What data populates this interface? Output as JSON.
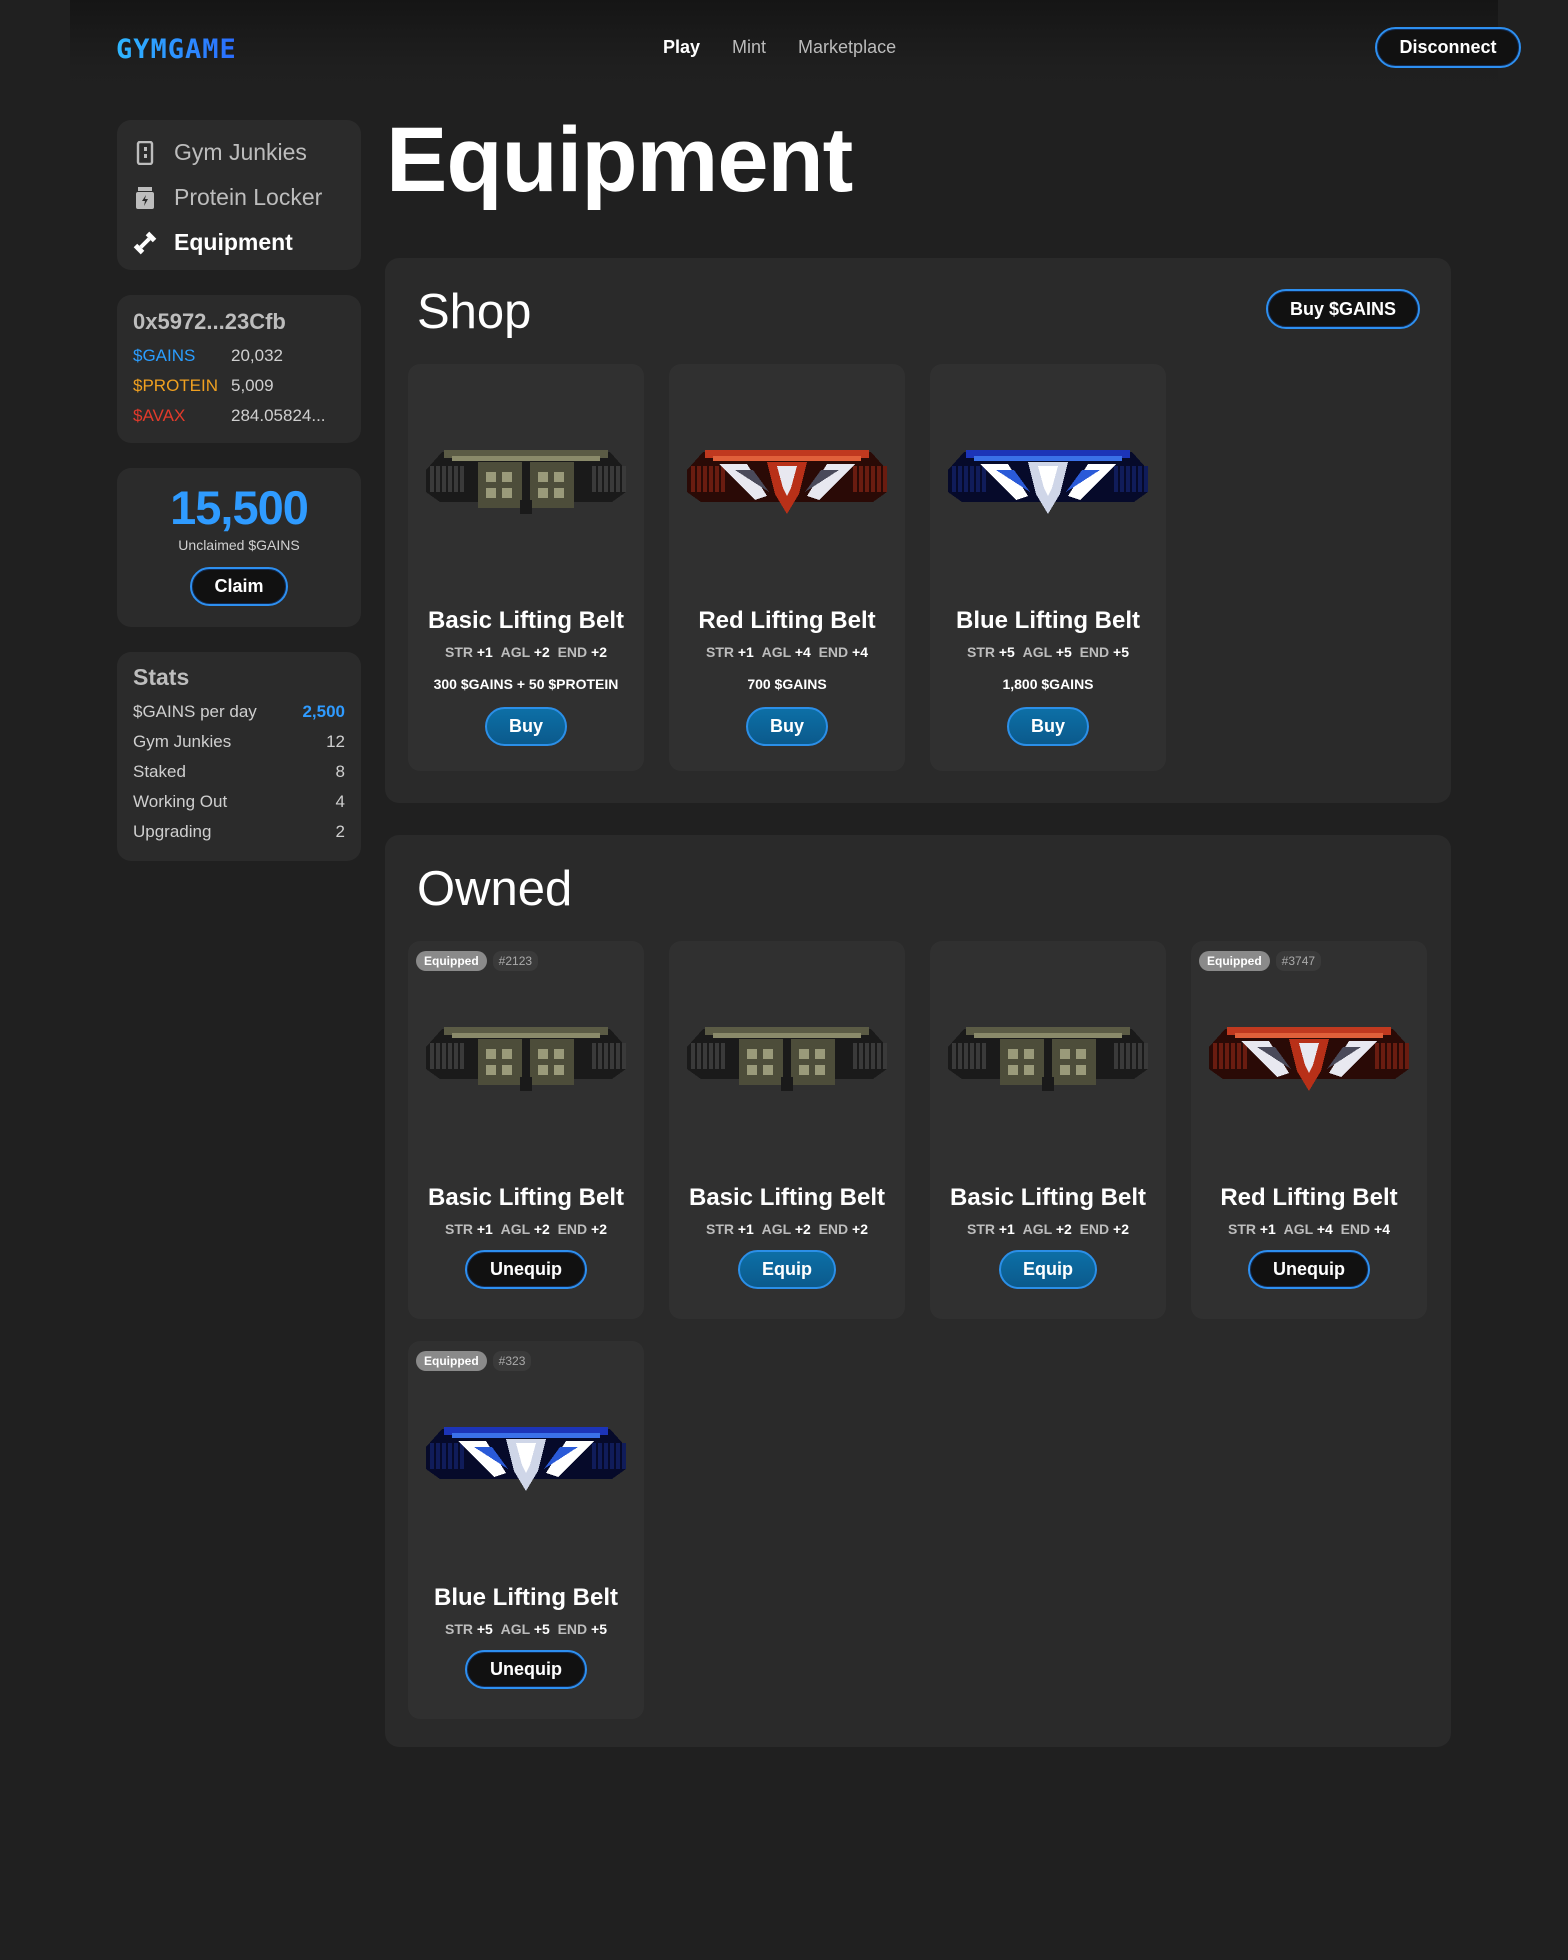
{
  "header": {
    "logo": "GYMGAME",
    "nav": [
      "Play",
      "Mint",
      "Marketplace"
    ],
    "disconnect_label": "Disconnect"
  },
  "sidebar": {
    "menu": [
      {
        "label": "Gym Junkies",
        "icon": "phone-icon"
      },
      {
        "label": "Protein Locker",
        "icon": "protein-jar-icon"
      },
      {
        "label": "Equipment",
        "icon": "dumbbell-icon"
      }
    ],
    "wallet": {
      "address": "0x5972...23Cfb",
      "balances": [
        {
          "token": "$GAINS",
          "value": "20,032",
          "color": "#2a9dff"
        },
        {
          "token": "$PROTEIN",
          "value": "5,009",
          "color": "#f0a020"
        },
        {
          "token": "$AVAX",
          "value": "284.05824...",
          "color": "#e23a2a"
        }
      ]
    },
    "unclaimed": {
      "amount": "15,500",
      "label": "Unclaimed $GAINS",
      "claim_label": "Claim"
    },
    "stats": {
      "title": "Stats",
      "rows": [
        {
          "label": "$GAINS per day",
          "value": "2,500"
        },
        {
          "label": "Gym Junkies",
          "value": "12"
        },
        {
          "label": "Staked",
          "value": "8"
        },
        {
          "label": "Working Out",
          "value": "4"
        },
        {
          "label": "Upgrading",
          "value": "2"
        }
      ]
    }
  },
  "main": {
    "title": "Equipment",
    "shop": {
      "title": "Shop",
      "buy_gains_label": "Buy $GAINS",
      "items": [
        {
          "name": "Basic Lifting Belt",
          "belt": "basic",
          "str": "+1",
          "agl": "+2",
          "end": "+2",
          "price": "300 $GAINS + 50 $PROTEIN",
          "button": "Buy"
        },
        {
          "name": "Red Lifting Belt",
          "belt": "red",
          "str": "+1",
          "agl": "+4",
          "end": "+4",
          "price": "700 $GAINS",
          "button": "Buy"
        },
        {
          "name": "Blue Lifting Belt",
          "belt": "blue",
          "str": "+5",
          "agl": "+5",
          "end": "+5",
          "price": "1,800 $GAINS",
          "button": "Buy"
        }
      ]
    },
    "owned": {
      "title": "Owned",
      "stat_labels": {
        "str": "STR",
        "agl": "AGL",
        "end": "END"
      },
      "items": [
        {
          "name": "Basic Lifting Belt",
          "belt": "basic",
          "str": "+1",
          "agl": "+2",
          "end": "+2",
          "badge": "Equipped",
          "id": "#2123",
          "button": "Unequip"
        },
        {
          "name": "Basic Lifting Belt",
          "belt": "basic",
          "str": "+1",
          "agl": "+2",
          "end": "+2",
          "button": "Equip"
        },
        {
          "name": "Basic Lifting Belt",
          "belt": "basic",
          "str": "+1",
          "agl": "+2",
          "end": "+2",
          "button": "Equip"
        },
        {
          "name": "Red Lifting Belt",
          "belt": "red",
          "str": "+1",
          "agl": "+4",
          "end": "+4",
          "badge": "Equipped",
          "id": "#3747",
          "button": "Unequip"
        },
        {
          "name": "Blue Lifting Belt",
          "belt": "blue",
          "str": "+5",
          "agl": "+5",
          "end": "+5",
          "badge": "Equipped",
          "id": "#323",
          "button": "Unequip"
        }
      ]
    }
  }
}
